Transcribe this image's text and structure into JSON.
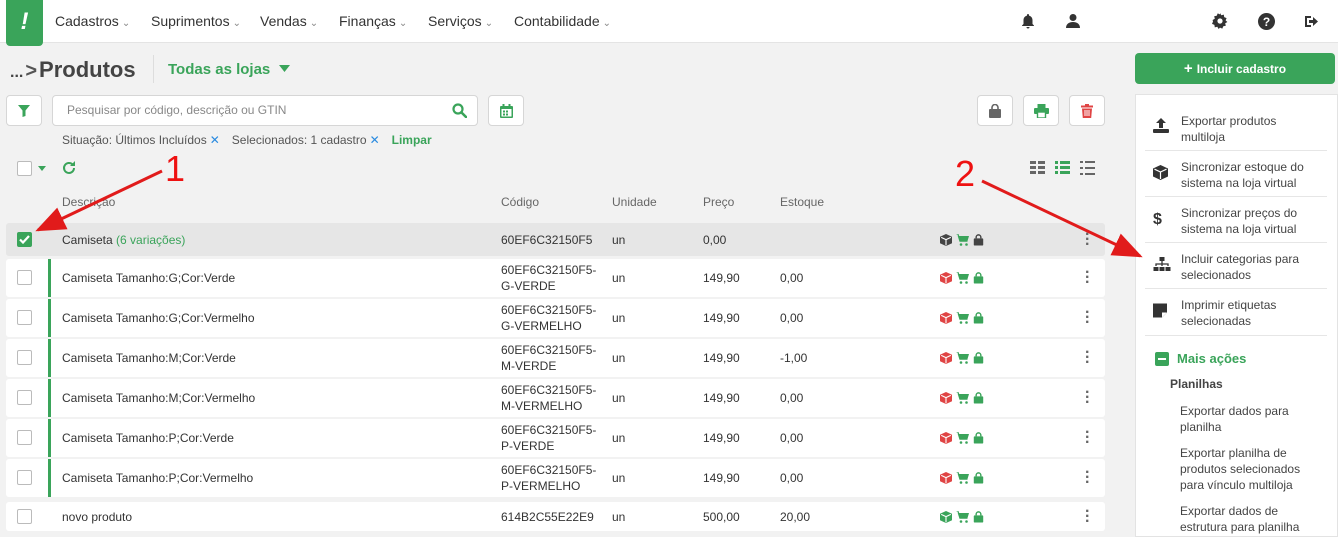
{
  "nav": {
    "logo": "!",
    "items": [
      "Cadastros",
      "Suprimentos",
      "Vendas",
      "Finanças",
      "Serviços",
      "Contabilidade"
    ]
  },
  "header": {
    "breadcrumb_ellipsis": "...",
    "breadcrumb_arrow": ">",
    "title": "Produtos",
    "store_selector": "Todas as lojas"
  },
  "search": {
    "placeholder": "Pesquisar por código, descrição ou GTIN"
  },
  "filters": {
    "situacao": "Situação: Últimos Incluídos",
    "selecionados": "Selecionados: 1 cadastro",
    "clear": "Limpar"
  },
  "table": {
    "columns": [
      "Descrição",
      "Código",
      "Unidade",
      "Preço",
      "Estoque"
    ],
    "rows": [
      {
        "desc": "Camiseta",
        "variations": "(6 variações)",
        "code1": "60EF6C32150F5",
        "code2": "",
        "unit": "un",
        "price": "0,00",
        "stock": "",
        "checked": true,
        "variant": false
      },
      {
        "desc": "Camiseta Tamanho:G;Cor:Verde",
        "variations": "",
        "code1": "60EF6C32150F5-",
        "code2": "G-VERDE",
        "unit": "un",
        "price": "149,90",
        "stock": "0,00",
        "checked": false,
        "variant": true
      },
      {
        "desc": "Camiseta Tamanho:G;Cor:Vermelho",
        "variations": "",
        "code1": "60EF6C32150F5-",
        "code2": "G-VERMELHO",
        "unit": "un",
        "price": "149,90",
        "stock": "0,00",
        "checked": false,
        "variant": true
      },
      {
        "desc": "Camiseta Tamanho:M;Cor:Verde",
        "variations": "",
        "code1": "60EF6C32150F5-",
        "code2": "M-VERDE",
        "unit": "un",
        "price": "149,90",
        "stock": "-1,00",
        "checked": false,
        "variant": true
      },
      {
        "desc": "Camiseta Tamanho:M;Cor:Vermelho",
        "variations": "",
        "code1": "60EF6C32150F5-",
        "code2": "M-VERMELHO",
        "unit": "un",
        "price": "149,90",
        "stock": "0,00",
        "checked": false,
        "variant": true
      },
      {
        "desc": "Camiseta Tamanho:P;Cor:Verde",
        "variations": "",
        "code1": "60EF6C32150F5-",
        "code2": "P-VERDE",
        "unit": "un",
        "price": "149,90",
        "stock": "0,00",
        "checked": false,
        "variant": true
      },
      {
        "desc": "Camiseta Tamanho:P;Cor:Vermelho",
        "variations": "",
        "code1": "60EF6C32150F5-",
        "code2": "P-VERMELHO",
        "unit": "un",
        "price": "149,90",
        "stock": "0,00",
        "checked": false,
        "variant": true
      },
      {
        "desc": "novo produto",
        "variations": "",
        "code1": "614B2C55E22E9",
        "code2": "",
        "unit": "un",
        "price": "500,00",
        "stock": "20,00",
        "checked": false,
        "variant": false
      }
    ]
  },
  "sidebar": {
    "primary_button": "Incluir cadastro",
    "actions": [
      {
        "icon": "upload-icon",
        "label1": "Exportar produtos",
        "label2": "multiloja"
      },
      {
        "icon": "cube-icon",
        "label1": "Sincronizar estoque do",
        "label2": "sistema na loja virtual"
      },
      {
        "icon": "dollar-icon",
        "label1": "Sincronizar preços do",
        "label2": "sistema na loja virtual"
      },
      {
        "icon": "sitemap-icon",
        "label1": "Incluir categorias para",
        "label2": "selecionados"
      },
      {
        "icon": "sticky-note-icon",
        "label1": "Imprimir etiquetas",
        "label2": "selecionadas"
      }
    ],
    "more_actions": "Mais ações",
    "section_title": "Planilhas",
    "section_items": [
      {
        "l1": "Exportar dados para",
        "l2": "planilha",
        "l3": ""
      },
      {
        "l1": "Exportar planilha de",
        "l2": "produtos selecionados",
        "l3": "para vínculo multiloja"
      },
      {
        "l1": "Exportar dados de",
        "l2": "estrutura para planilha",
        "l3": ""
      }
    ]
  },
  "annotations": {
    "label1": "1",
    "label2": "2",
    "color": "#e11b1b"
  },
  "colors": {
    "accent": "#3aa45a",
    "danger": "#e04444",
    "link": "#2a8be0"
  }
}
